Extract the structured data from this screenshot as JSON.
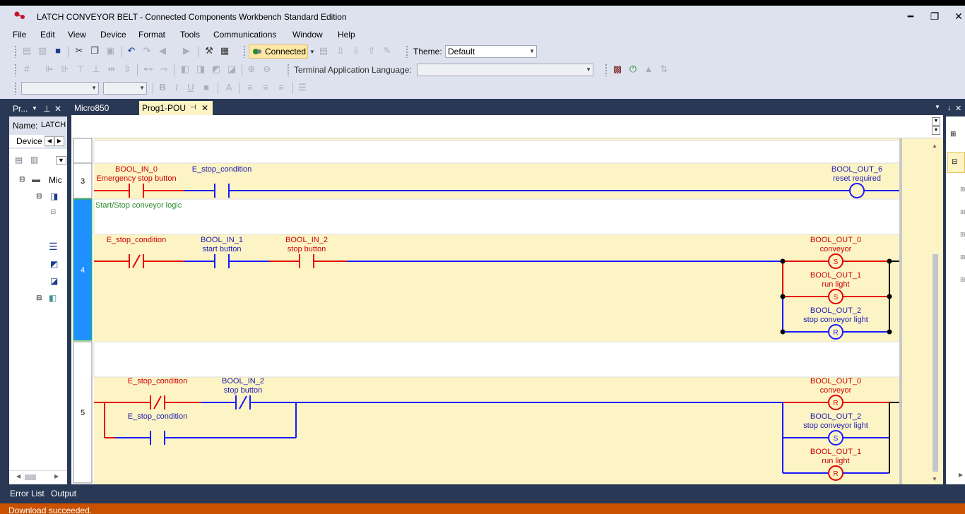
{
  "window": {
    "title": "LATCH CONVEYOR BELT - Connected Components Workbench Standard Edition",
    "minimize": "━",
    "restore": "❐",
    "close": "✕"
  },
  "menu": [
    "File",
    "Edit",
    "View",
    "Device",
    "Format",
    "Tools",
    "Communications",
    "Window",
    "Help"
  ],
  "toolbar": {
    "connected_label": "Connected",
    "theme_label": "Theme:",
    "theme_value": "Default",
    "terminal_language_label": "Terminal Application Language:",
    "terminal_language_value": ""
  },
  "project_pane": {
    "title": "Pr...",
    "name_label": "Name:",
    "name_value": "LATCH",
    "device_tab": "Device",
    "tree_root": "Mic"
  },
  "tabs": [
    {
      "label": "Micro850",
      "active": false
    },
    {
      "label": "Prog1-POU",
      "active": true
    }
  ],
  "right_pane": {
    "title": "↓"
  },
  "bottom_tabs": [
    "Error List",
    "Output"
  ],
  "status": "Download succeeded.",
  "colors": {
    "wire_blue": "#1a1aff",
    "wire_red": "#e60000",
    "label_red": "#cc0000",
    "label_blue": "#1a1ab0",
    "comment_green": "#2b8a2b",
    "rung_bg": "#fdf4c6",
    "selected_rung": "#1e90ff",
    "status_orange": "#ca5100"
  },
  "rungs": [
    {
      "number": "3",
      "comment": "",
      "elements": [
        {
          "type": "contact_no",
          "variable": "BOOL_IN_0",
          "description": "Emergency stop button",
          "state": "on"
        },
        {
          "type": "contact_no",
          "variable": "E_stop_condition",
          "description": "",
          "state": "off"
        },
        {
          "type": "coil",
          "variable": "BOOL_OUT_6",
          "description": "reset required",
          "state": "off"
        }
      ]
    },
    {
      "number": "4",
      "comment": "Start/Stop conveyor logic",
      "elements": [
        {
          "type": "contact_nc",
          "variable": "E_stop_condition",
          "description": "",
          "state": "on"
        },
        {
          "type": "contact_no",
          "variable": "BOOL_IN_1",
          "description": "start button",
          "state": "off"
        },
        {
          "type": "contact_no",
          "variable": "BOOL_IN_2",
          "description": "stop button",
          "state": "on"
        },
        {
          "type": "coil_set",
          "variable": "BOOL_OUT_0",
          "description": "conveyor",
          "state": "on",
          "letter": "S"
        },
        {
          "type": "coil_set",
          "variable": "BOOL_OUT_1",
          "description": "run light",
          "state": "on",
          "letter": "S"
        },
        {
          "type": "coil_reset",
          "variable": "BOOL_OUT_2",
          "description": "stop conveyor light",
          "state": "off",
          "letter": "R"
        }
      ]
    },
    {
      "number": "5",
      "comment": "",
      "elements": [
        {
          "type": "contact_nc",
          "variable": "E_stop_condition",
          "description": "",
          "state": "on"
        },
        {
          "type": "contact_nc",
          "variable": "BOOL_IN_2",
          "description": "stop button",
          "state": "off"
        },
        {
          "type": "contact_no",
          "variable": "E_stop_condition",
          "description": "",
          "state": "off"
        },
        {
          "type": "coil_reset",
          "variable": "BOOL_OUT_0",
          "description": "conveyor",
          "state": "on",
          "letter": "R"
        },
        {
          "type": "coil_set",
          "variable": "BOOL_OUT_2",
          "description": "stop conveyor light",
          "state": "off",
          "letter": "S"
        },
        {
          "type": "coil_reset",
          "variable": "BOOL_OUT_1",
          "description": "run light",
          "state": "on",
          "letter": "R"
        }
      ]
    }
  ]
}
